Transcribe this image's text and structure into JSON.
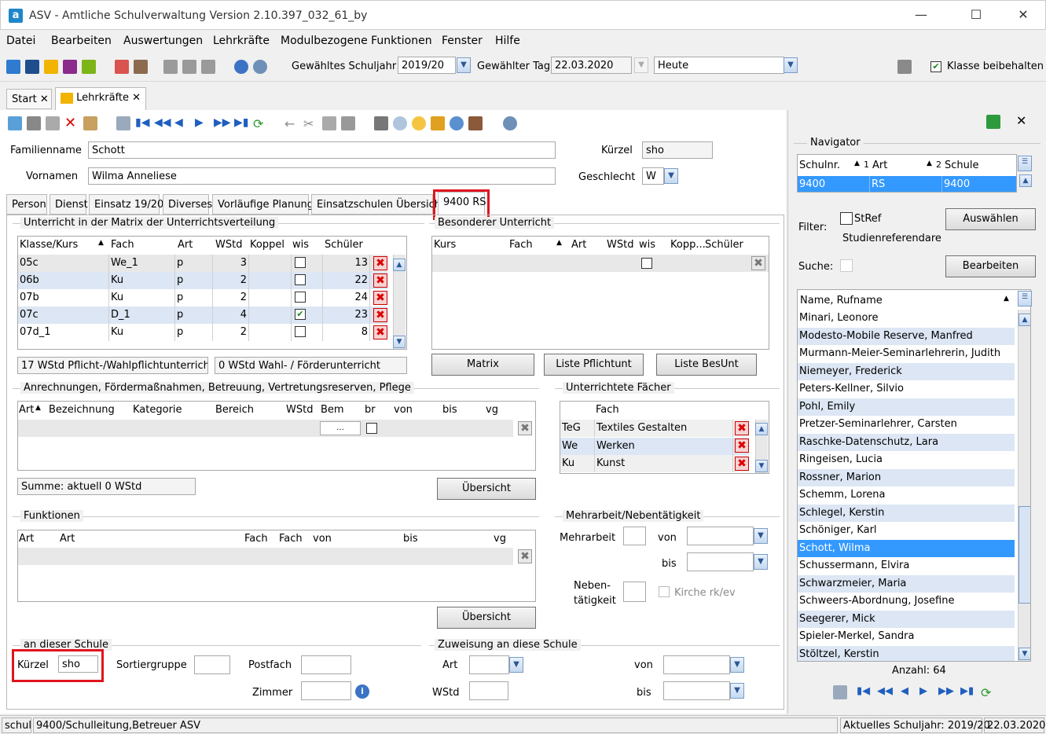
{
  "window": {
    "title": "ASV - Amtliche Schulverwaltung Version 2.10.397_032_61_by",
    "logo_letter": "a"
  },
  "menu": [
    "Datei",
    "Bearbeiten",
    "Auswertungen",
    "Lehrkräfte",
    "Modulbezogene Funktionen",
    "Fenster",
    "Hilfe"
  ],
  "toolbar": {
    "schuljahr_label": "Gewähltes Schuljahr",
    "schuljahr_value": "2019/20",
    "tag_label": "Gewählter Tag",
    "tag_value": "22.03.2020",
    "heute_value": "Heute",
    "klasse_label": "Klasse beibehalten",
    "klasse_checked": true
  },
  "main_tabs": [
    {
      "label": "Start"
    },
    {
      "label": "Lehrkräfte"
    }
  ],
  "form": {
    "familienname_label": "Familienname",
    "familienname_value": "Schott",
    "vornamen_label": "Vornamen",
    "vornamen_value": "Wilma Anneliese",
    "kuerzel_label": "Kürzel",
    "kuerzel_value": "sho",
    "geschlecht_label": "Geschlecht",
    "geschlecht_value": "W"
  },
  "sub_tabs": [
    "Person",
    "Dienst",
    "Einsatz 19/20",
    "Diverses",
    "Vorläufige Planung",
    "Einsatzschulen Übersicht",
    "9400 RS"
  ],
  "unterricht": {
    "title": "Unterricht in der Matrix der Unterrichtsverteilung",
    "headers": [
      "Klasse/Kurs",
      "Fach",
      "Art",
      "WStd",
      "Koppel",
      "wis",
      "Schüler"
    ],
    "rows": [
      {
        "klasse": "05c",
        "fach": "We_1",
        "art": "p",
        "wstd": "3",
        "koppel": "",
        "wis": false,
        "schueler": "13"
      },
      {
        "klasse": "06b",
        "fach": "Ku",
        "art": "p",
        "wstd": "2",
        "koppel": "",
        "wis": false,
        "schueler": "22"
      },
      {
        "klasse": "07b",
        "fach": "Ku",
        "art": "p",
        "wstd": "2",
        "koppel": "",
        "wis": false,
        "schueler": "24"
      },
      {
        "klasse": "07c",
        "fach": "D_1",
        "art": "p",
        "wstd": "4",
        "koppel": "",
        "wis": true,
        "schueler": "23"
      },
      {
        "klasse": "07d_1",
        "fach": "Ku",
        "art": "p",
        "wstd": "2",
        "koppel": "",
        "wis": false,
        "schueler": "8"
      }
    ],
    "sum_pflicht": "17 WStd Pflicht-/Wahlpflichtunterricht",
    "sum_wahl": "0 WStd Wahl- / Förderunterricht"
  },
  "besonderer": {
    "title": "Besonderer Unterricht",
    "headers": [
      "Kurs",
      "Fach",
      "Art",
      "WStd",
      "wis",
      "Kopp...",
      "Schüler"
    ],
    "btn_matrix": "Matrix",
    "btn_pflicht": "Liste Pflichtunt",
    "btn_besunt": "Liste BesUnt"
  },
  "anrechnungen": {
    "title": "Anrechnungen, Fördermaßnahmen, Betreuung, Vertretungsreserven, Pflege",
    "headers": [
      "Art",
      "Bezeichnung",
      "Kategorie",
      "Bereich",
      "WStd",
      "Bem",
      "br",
      "von",
      "bis",
      "vg"
    ],
    "bem_button": "...",
    "summe": "Summe: aktuell 0 WStd",
    "btn": "Übersicht"
  },
  "faecher": {
    "title": "Unterrichtete Fächer",
    "header": "Fach",
    "rows": [
      {
        "code": "TeG",
        "name": "Textiles Gestalten"
      },
      {
        "code": "We",
        "name": "Werken"
      },
      {
        "code": "Ku",
        "name": "Kunst"
      }
    ]
  },
  "funktionen": {
    "title": "Funktionen",
    "headers": [
      "Art",
      "Art",
      "Fach",
      "Fach",
      "von",
      "bis",
      "vg"
    ],
    "btn": "Übersicht"
  },
  "mehrarbeit": {
    "title": "Mehrarbeit/Nebentätigkeit",
    "mehrarbeit_label": "Mehrarbeit",
    "von_label": "von",
    "bis_label": "bis",
    "neben_label_1": "Neben-",
    "neben_label_2": "tätigkeit",
    "kirche_label": "Kirche rk/ev"
  },
  "schule": {
    "title": "an dieser Schule",
    "kuerzel_label": "Kürzel",
    "kuerzel_value": "sho",
    "sortier_label": "Sortiergruppe",
    "postfach_label": "Postfach",
    "zimmer_label": "Zimmer"
  },
  "zuweisung": {
    "title": "Zuweisung an diese Schule",
    "art_label": "Art",
    "wstd_label": "WStd",
    "von_label": "von",
    "bis_label": "bis"
  },
  "navigator": {
    "title": "Navigator",
    "headers": [
      "Schulnr.",
      "Art",
      "Schule"
    ],
    "sort_markers": [
      "1",
      "2"
    ],
    "row": {
      "schulnr": "9400",
      "art": "RS",
      "schule": "9400"
    },
    "filter_label": "Filter:",
    "stref_label": "StRef",
    "stref_desc": "Studienreferendare",
    "btn_auswaehlen": "Auswählen",
    "suche_label": "Suche:",
    "btn_bearbeiten": "Bearbeiten",
    "list_header": "Name, Rufname",
    "names": [
      "Minari, Leonore",
      "Modesto-Mobile Reserve, Manfred",
      "Murmann-Meier-Seminarlehrerin, Judith",
      "Niemeyer, Frederick",
      "Peters-Kellner, Silvio",
      "Pohl, Emily",
      "Pretzer-Seminarlehrer, Carsten",
      "Raschke-Datenschutz, Lara",
      "Ringeisen, Lucia",
      "Rossner, Marion",
      "Schemm, Lorena",
      "Schlegel, Kerstin",
      "Schöniger, Karl",
      "Schott, Wilma",
      "Schussermann, Elvira",
      "Schwarzmeier, Maria",
      "Schweers-Abordnung, Josefine",
      "Seegerer, Mick",
      "Spieler-Merkel, Sandra",
      "Stöltzel, Kerstin"
    ],
    "selected_index": 13,
    "anzahl": "Anzahl: 64"
  },
  "status": {
    "left": "schul",
    "middle": "9400/Schulleitung,Betreuer ASV",
    "schuljahr": "Aktuelles Schuljahr: 2019/20",
    "date": "22.03.2020"
  },
  "colors": {
    "selected": "#3399ff",
    "alt_row": "#dce6f4",
    "highlight_red": "#e0141e"
  }
}
